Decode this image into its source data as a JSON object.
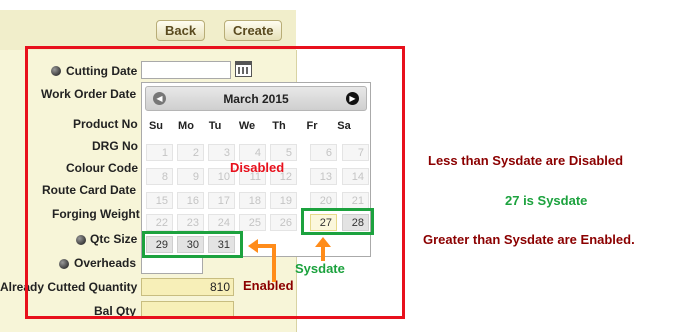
{
  "toolbar": {
    "back_label": "Back",
    "create_label": "Create"
  },
  "form": {
    "cutting_date": "Cutting Date",
    "work_order_date": "Work Order Date",
    "product_no": "Product No",
    "drg_no": "DRG No",
    "colour_code": "Colour Code",
    "route_card_date": "Route Card Date",
    "forging_weight": "Forging Weight",
    "qtc_size": "Qtc Size",
    "overheads": "Overheads",
    "already_cutted_quantity": "Already Cutted Quantity",
    "already_cutted_value": "810",
    "bal_qty": "Bal Qty"
  },
  "calendar": {
    "month_title": "March 2015",
    "weekdays": [
      "Su",
      "Mo",
      "Tu",
      "We",
      "Th",
      "Fr",
      "Sa"
    ],
    "rows": [
      [
        "1",
        "2",
        "3",
        "4",
        "5",
        "6",
        "7"
      ],
      [
        "8",
        "9",
        "10",
        "11",
        "12",
        "13",
        "14"
      ],
      [
        "15",
        "16",
        "17",
        "18",
        "19",
        "20",
        "21"
      ],
      [
        "22",
        "23",
        "24",
        "25",
        "26",
        "27",
        "28"
      ],
      [
        "29",
        "30",
        "31"
      ]
    ],
    "today": "27"
  },
  "annotations": {
    "disabled": "Disabled",
    "enabled": "Enabled",
    "sysdate": "Sysdate",
    "note_less": "Less than Sysdate are Disabled",
    "note_sysdate": "27 is Sysdate",
    "note_greater": "Greater than Sysdate are Enabled."
  },
  "colors": {
    "red": "#e8101c",
    "green": "#1ca23e",
    "orange": "#ff8c1a",
    "dark_red": "#8b0000"
  }
}
